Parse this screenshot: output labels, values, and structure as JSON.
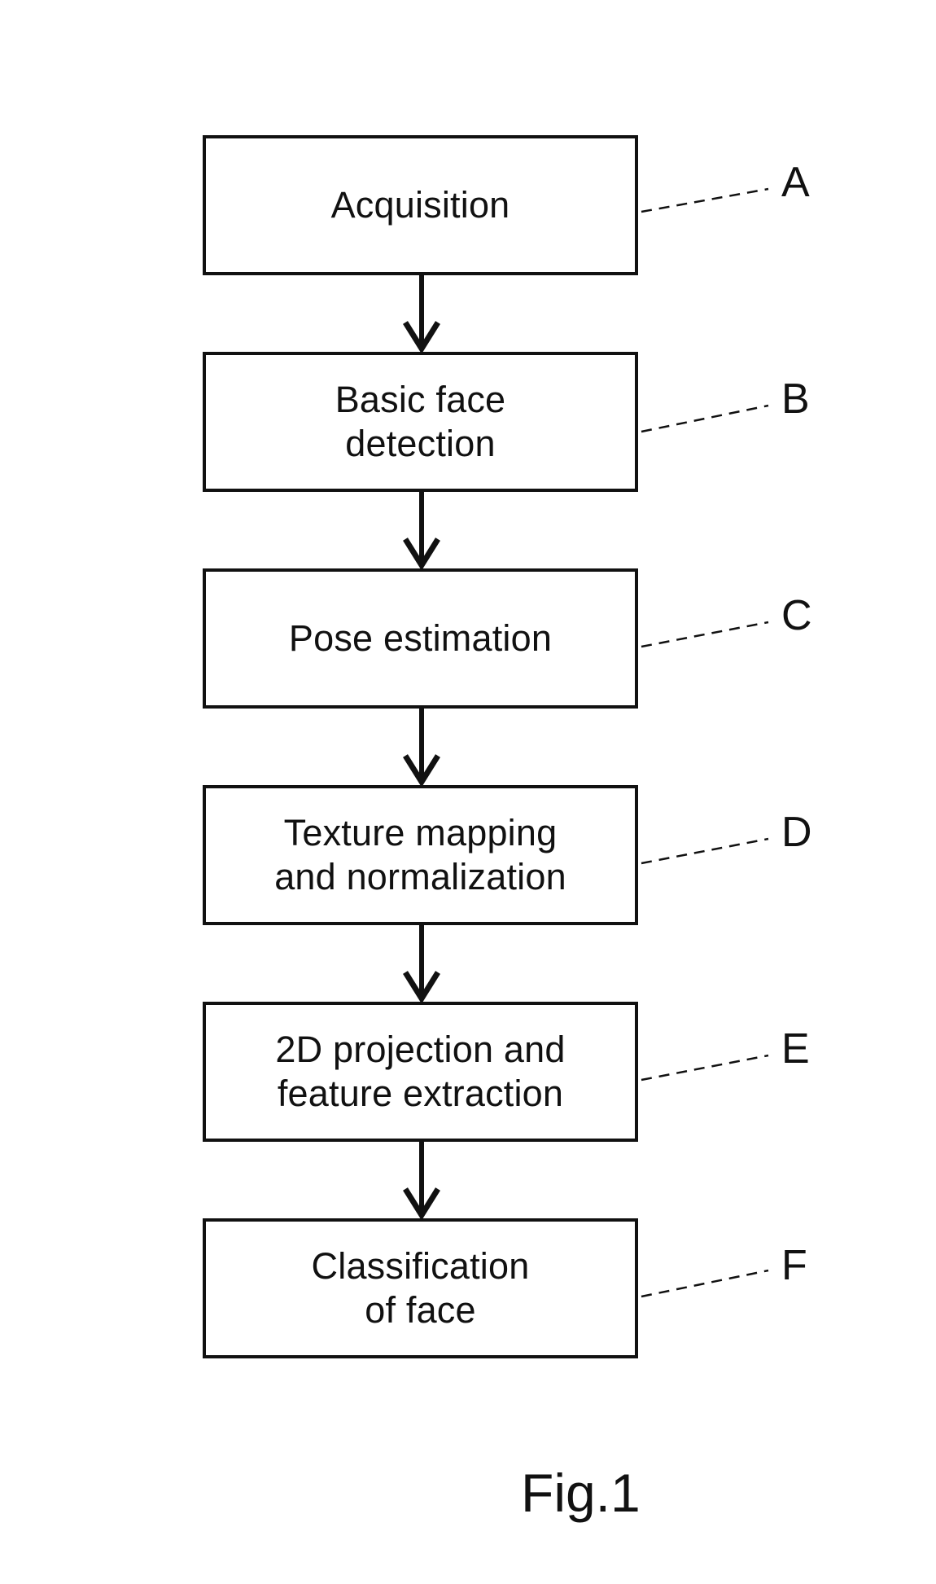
{
  "figure": {
    "caption": "Fig.1",
    "type": "flowchart",
    "orientation": "vertical",
    "background_color": "#ffffff",
    "line_color": "#111111",
    "box_fill_color": "#ffffff"
  },
  "flowchart": {
    "steps": [
      {
        "ref": "A",
        "text": "Acquisition",
        "lines": [
          "Acquisition"
        ]
      },
      {
        "ref": "B",
        "text": "Basic face detection",
        "lines": [
          "Basic face",
          "detection"
        ]
      },
      {
        "ref": "C",
        "text": "Pose estimation",
        "lines": [
          "Pose estimation"
        ]
      },
      {
        "ref": "D",
        "text": "Texture mapping and normalization",
        "lines": [
          "Texture mapping",
          "and normalization"
        ]
      },
      {
        "ref": "E",
        "text": "2D projection and feature extraction",
        "lines": [
          "2D projection and",
          "feature extraction"
        ]
      },
      {
        "ref": "F",
        "text": "Classification of face",
        "lines": [
          "Classification",
          "of face"
        ]
      }
    ],
    "connectors": [
      {
        "from": "A",
        "to": "B",
        "style": "arrow-down"
      },
      {
        "from": "B",
        "to": "C",
        "style": "arrow-down"
      },
      {
        "from": "C",
        "to": "D",
        "style": "arrow-down"
      },
      {
        "from": "D",
        "to": "E",
        "style": "arrow-down"
      },
      {
        "from": "E",
        "to": "F",
        "style": "arrow-down"
      }
    ]
  }
}
